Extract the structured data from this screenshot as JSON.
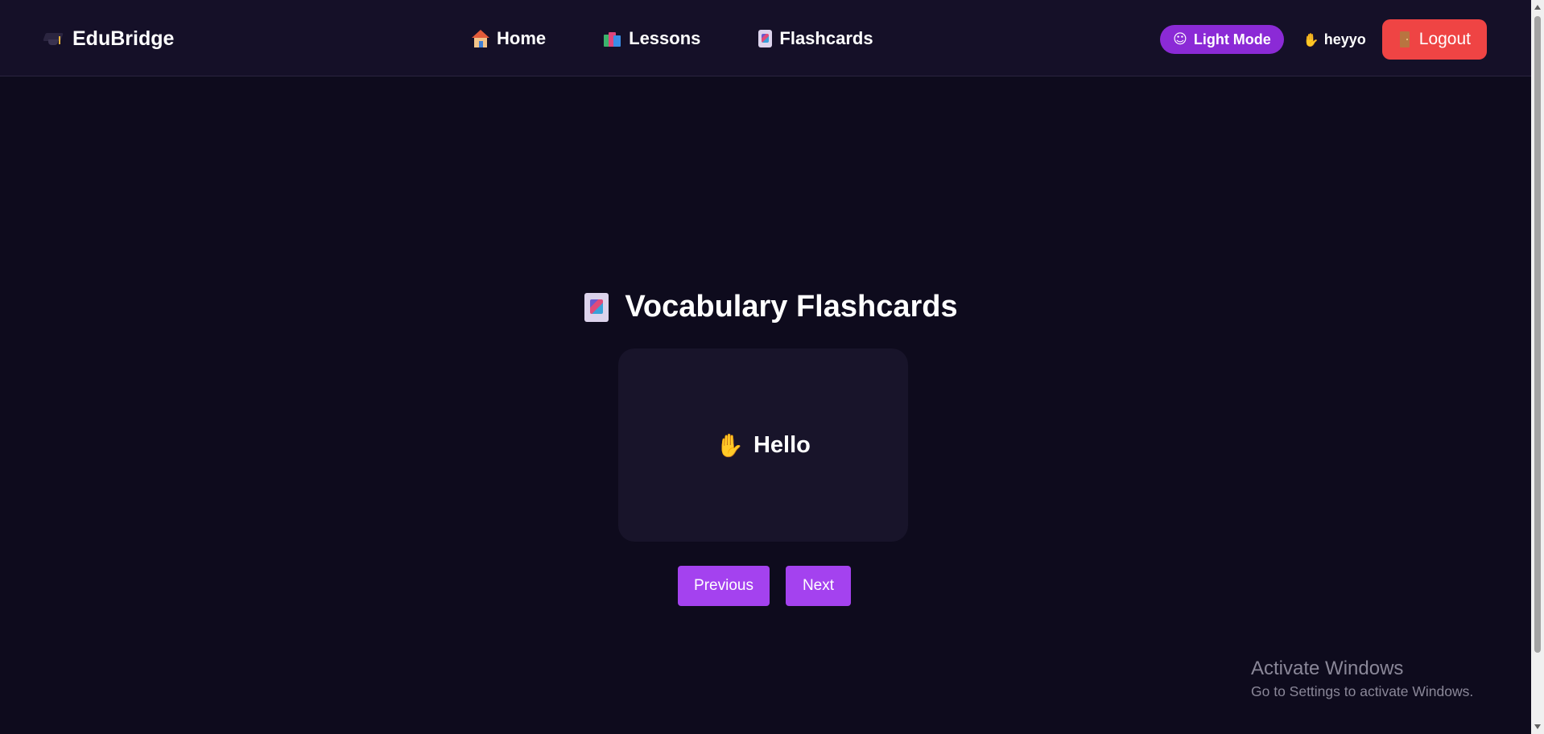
{
  "navbar": {
    "brand": {
      "icon": "graduation-cap-icon",
      "label": "EduBridge"
    },
    "links": [
      {
        "icon": "house-icon",
        "label": "Home"
      },
      {
        "icon": "books-icon",
        "label": "Lessons"
      },
      {
        "icon": "card-index-icon",
        "label": "Flashcards"
      }
    ],
    "theme_toggle": {
      "icon": "sun-face-icon",
      "label": "Light Mode"
    },
    "greeting": {
      "icon": "waving-hand-icon",
      "label": "heyyo"
    },
    "logout": {
      "icon": "door-icon",
      "label": "Logout"
    }
  },
  "main": {
    "title": "Vocabulary Flashcards",
    "title_icon": "card-index-icon",
    "flashcard": {
      "icon": "waving-hand-icon",
      "word": "Hello"
    },
    "previous_label": "Previous",
    "next_label": "Next"
  },
  "watermark": {
    "title": "Activate Windows",
    "subtitle": "Go to Settings to activate Windows."
  },
  "colors": {
    "background": "#0e0b1d",
    "navbar": "#151028",
    "card": "#18142a",
    "accent_purple": "#a442ef",
    "toggle_purple": "#8b2ad6",
    "logout_red": "#ef4444"
  }
}
